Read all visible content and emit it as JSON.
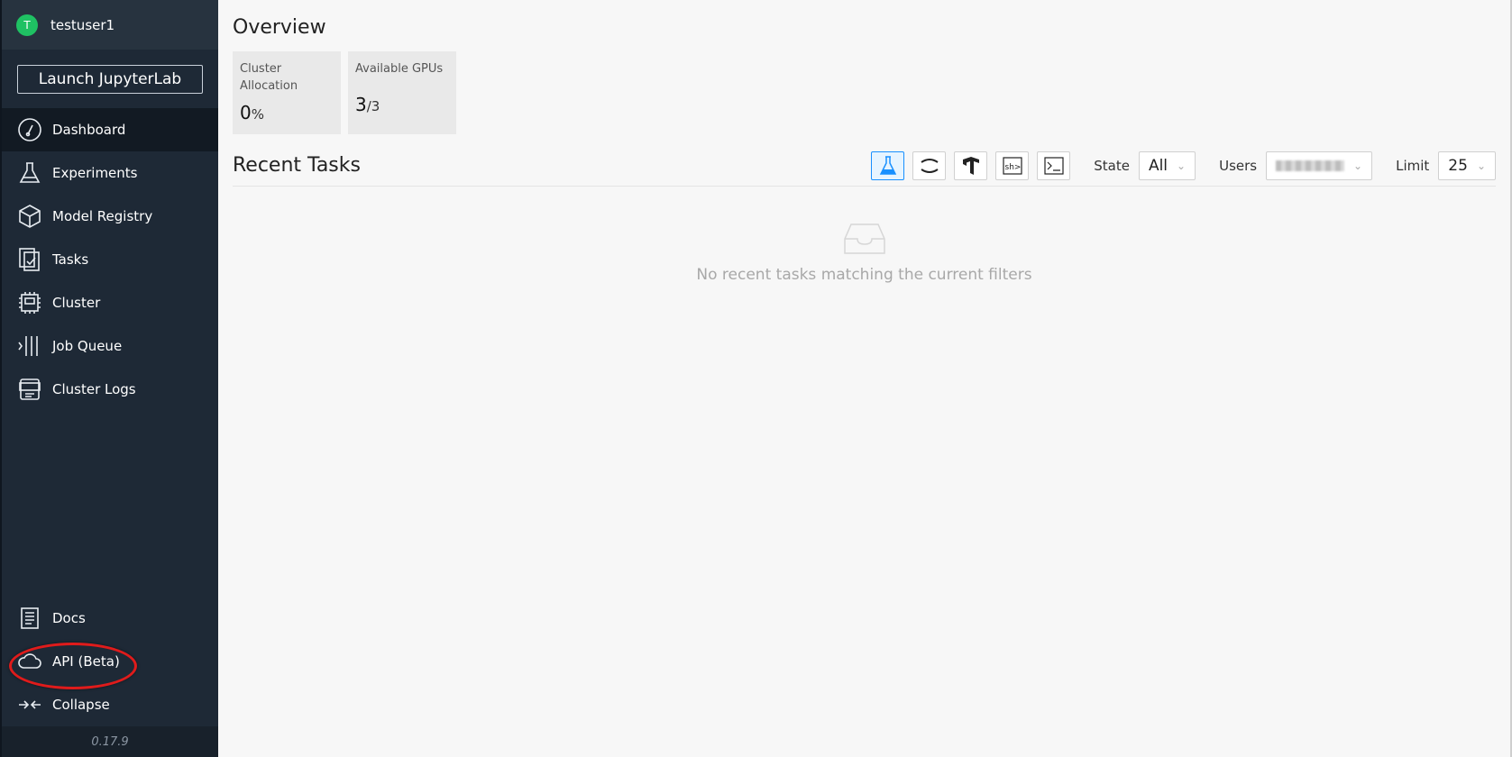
{
  "user": {
    "initial": "T",
    "name": "testuser1"
  },
  "sidebar": {
    "launch_label": "Launch JupyterLab",
    "items": [
      {
        "label": "Dashboard",
        "icon": "dashboard-gauge-icon"
      },
      {
        "label": "Experiments",
        "icon": "flask-icon"
      },
      {
        "label": "Model Registry",
        "icon": "cube-icon"
      },
      {
        "label": "Tasks",
        "icon": "tasks-icon"
      },
      {
        "label": "Cluster",
        "icon": "chip-icon"
      },
      {
        "label": "Job Queue",
        "icon": "queue-icon"
      },
      {
        "label": "Cluster Logs",
        "icon": "log-icon"
      }
    ],
    "bottom_items": [
      {
        "label": "Docs",
        "icon": "docs-icon"
      },
      {
        "label": "API (Beta)",
        "icon": "cloud-icon"
      },
      {
        "label": "Collapse",
        "icon": "collapse-icon"
      }
    ],
    "version": "0.17.9"
  },
  "overview": {
    "title": "Overview",
    "cluster_allocation": {
      "label": "Cluster Allocation",
      "value": "0",
      "unit": "%"
    },
    "available_gpus": {
      "label": "Available GPUs",
      "value": "3",
      "total": "/3"
    }
  },
  "recent_tasks": {
    "title": "Recent Tasks",
    "state_label": "State",
    "state_value": "All",
    "users_label": "Users",
    "limit_label": "Limit",
    "limit_value": "25",
    "empty_text": "No recent tasks matching the current filters"
  },
  "colors": {
    "sidebar_bg": "#1e2936",
    "accent": "#1890ff",
    "avatar": "#1fc163",
    "highlight": "#e01b1b"
  }
}
